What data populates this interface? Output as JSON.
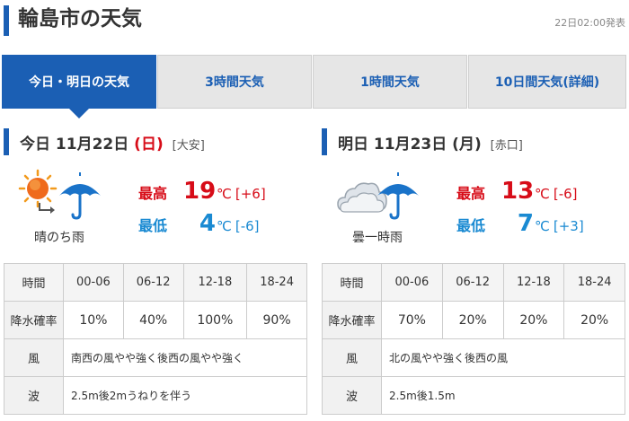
{
  "header": {
    "title": "輪島市の天気",
    "issued": "22日02:00発表"
  },
  "tabs": [
    {
      "label": "今日・明日の天気",
      "active": true
    },
    {
      "label": "3時間天気",
      "active": false
    },
    {
      "label": "1時間天気",
      "active": false
    },
    {
      "label": "10日間天気(詳細)",
      "active": false
    }
  ],
  "today": {
    "prefix": "今日",
    "date": "11月22日",
    "dow": "(日)",
    "rokuyo": "[大安]",
    "weather": "晴のち雨",
    "icon": "sun-then-rain-icon",
    "high_label": "最高",
    "high": "19",
    "high_unit": "℃",
    "high_diff": "[+6]",
    "low_label": "最低",
    "low": "4",
    "low_unit": "℃",
    "low_diff": "[-6]",
    "table": {
      "time_label": "時間",
      "times": [
        "00-06",
        "06-12",
        "12-18",
        "18-24"
      ],
      "prob_label": "降水確率",
      "probs": [
        "10%",
        "40%",
        "100%",
        "90%"
      ],
      "wind_label": "風",
      "wind": "南西の風やや強く後西の風やや強く",
      "wave_label": "波",
      "wave": "2.5m後2mうねりを伴う"
    }
  },
  "tomorrow": {
    "prefix": "明日",
    "date": "11月23日",
    "dow": "(月)",
    "rokuyo": "[赤口]",
    "weather": "曇一時雨",
    "icon": "cloud-with-rain-icon",
    "high_label": "最高",
    "high": "13",
    "high_unit": "℃",
    "high_diff": "[-6]",
    "low_label": "最低",
    "low": "7",
    "low_unit": "℃",
    "low_diff": "[+3]",
    "table": {
      "time_label": "時間",
      "times": [
        "00-06",
        "06-12",
        "12-18",
        "18-24"
      ],
      "prob_label": "降水確率",
      "probs": [
        "70%",
        "20%",
        "20%",
        "20%"
      ],
      "wind_label": "風",
      "wind": "北の風やや強く後西の風",
      "wave_label": "波",
      "wave": "2.5m後1.5m"
    }
  },
  "colors": {
    "accent": "#1b5fb4",
    "high": "#d70c18",
    "low": "#1a8ad2",
    "sunday": "#d70c18"
  }
}
